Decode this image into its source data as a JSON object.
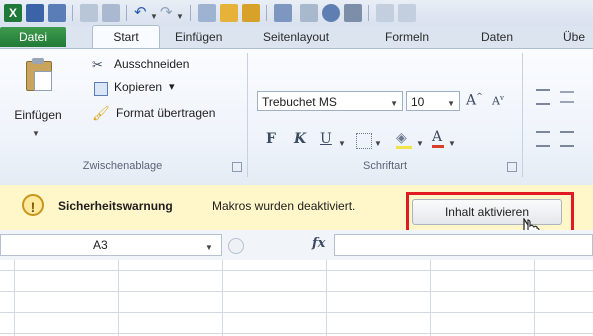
{
  "ribbon_tabs": [
    "Datei",
    "Start",
    "Einfügen",
    "Seitenlayout",
    "Formeln",
    "Daten",
    "Übe"
  ],
  "clipboard": {
    "paste": "Einfügen",
    "cut": "Ausschneiden",
    "copy": "Kopieren",
    "copy_arrow": "▾",
    "format_painter": "Format übertragen",
    "group_label": "Zwischenablage"
  },
  "font": {
    "name": "Trebuchet MS",
    "size": "10",
    "bold": "F",
    "italic": "K",
    "underline": "U",
    "group_label": "Schriftart"
  },
  "security_bar": {
    "title": "Sicherheitswarnung",
    "message": "Makros wurden deaktiviert.",
    "button": "Inhalt aktivieren"
  },
  "formula_bar": {
    "name_box": "A3",
    "fx": "fx"
  },
  "colors": {
    "datei_tab": "#217a35",
    "security_bar_bg": "#fff6c9",
    "highlight": "#e11b22"
  }
}
